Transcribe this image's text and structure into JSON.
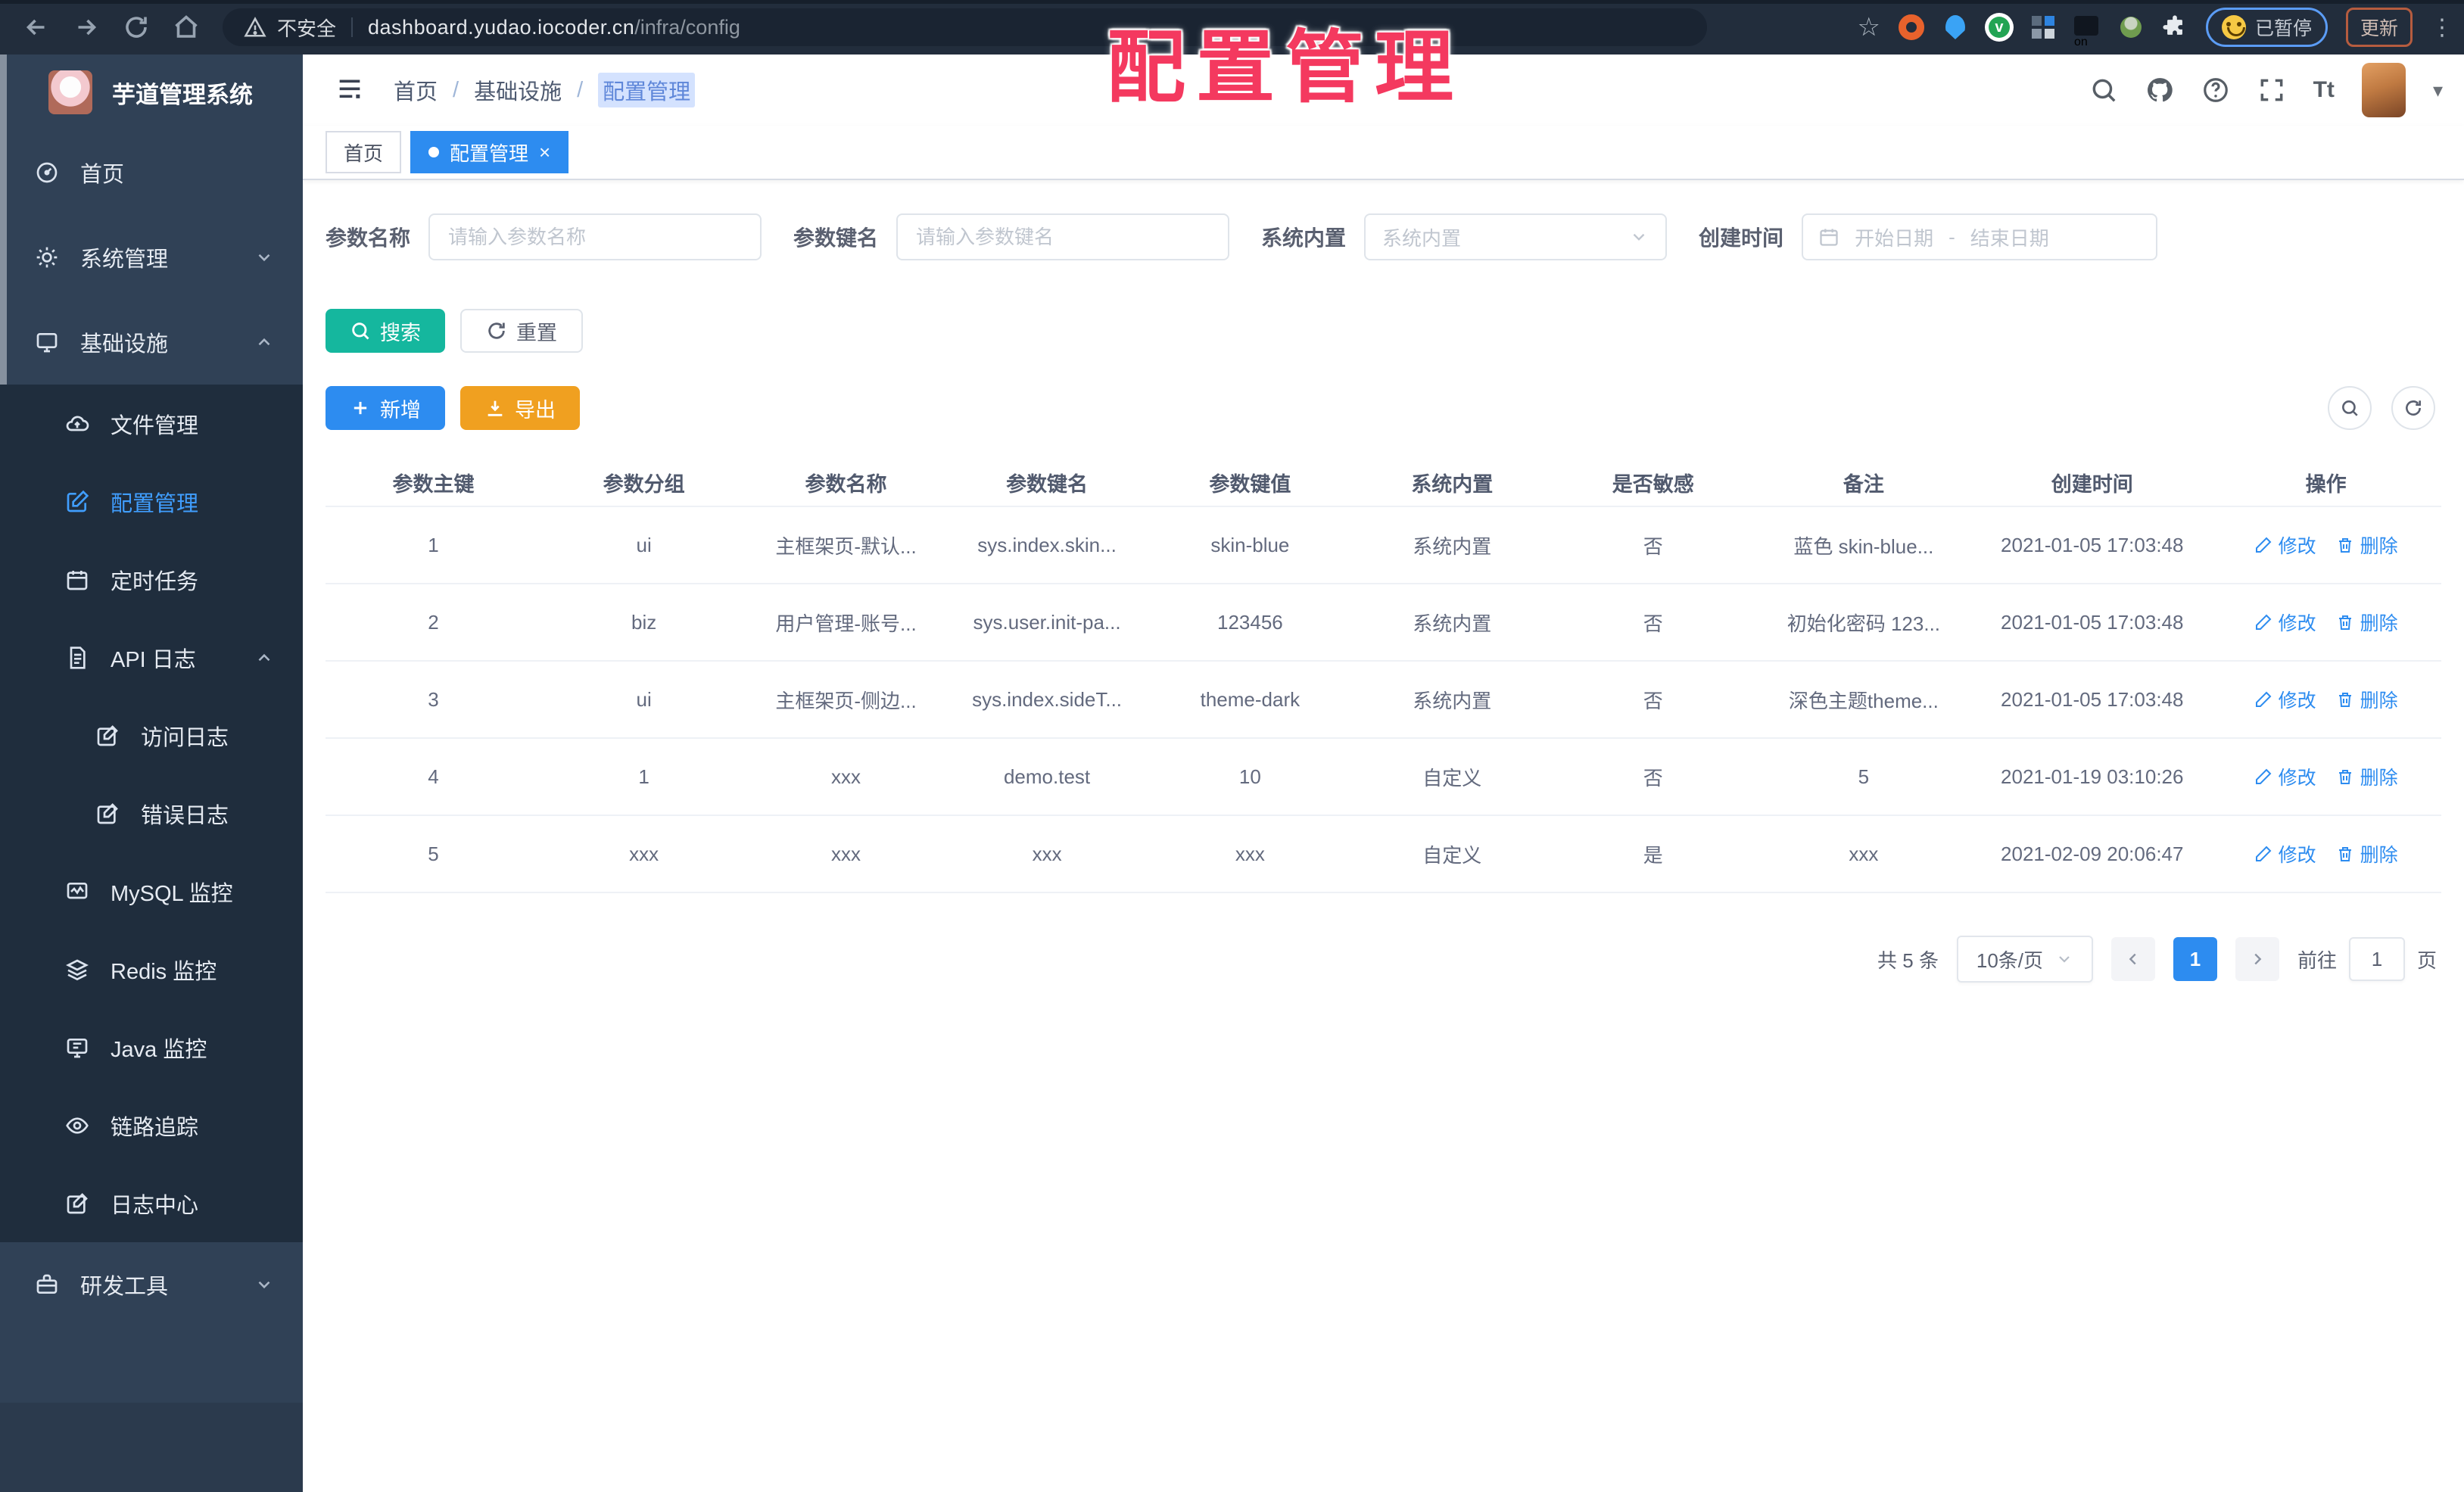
{
  "icons": {
    "close": "×",
    "caret_down": "▾",
    "kebab": "⋮",
    "star": "☆",
    "question": "?",
    "font_size": "Tt",
    "dash": "-"
  },
  "browser": {
    "security_label": "不安全",
    "url_host": "dashboard.yudao.iocoder.cn",
    "url_path": "/infra/config",
    "paused_label": "已暂停",
    "update_label": "更新",
    "on_badge": "on"
  },
  "overlay": {
    "title": "配置管理",
    "color": "#f4395f"
  },
  "sidebar": {
    "title": "芋道管理系统",
    "items": [
      {
        "label": "首页"
      },
      {
        "label": "系统管理"
      },
      {
        "label": "基础设施"
      },
      {
        "label": "文件管理"
      },
      {
        "label": "配置管理"
      },
      {
        "label": "定时任务"
      },
      {
        "label": "API 日志"
      },
      {
        "label": "访问日志"
      },
      {
        "label": "错误日志"
      },
      {
        "label": "MySQL 监控"
      },
      {
        "label": "Redis 监控"
      },
      {
        "label": "Java 监控"
      },
      {
        "label": "链路追踪"
      },
      {
        "label": "日志中心"
      },
      {
        "label": "研发工具"
      }
    ]
  },
  "header": {
    "breadcrumb": [
      "首页",
      "基础设施",
      "配置管理"
    ],
    "separator": "/"
  },
  "tabs": [
    {
      "label": "首页"
    },
    {
      "label": "配置管理"
    }
  ],
  "filters": {
    "param_name": {
      "label": "参数名称",
      "placeholder": "请输入参数名称",
      "value": ""
    },
    "param_key": {
      "label": "参数键名",
      "placeholder": "请输入参数键名",
      "value": ""
    },
    "system_builtin": {
      "label": "系统内置",
      "placeholder": "系统内置"
    },
    "create_time": {
      "label": "创建时间",
      "start_placeholder": "开始日期",
      "separator": "-",
      "end_placeholder": "结束日期"
    }
  },
  "buttons": {
    "search": "搜索",
    "reset": "重置",
    "add": "新增",
    "export": "导出"
  },
  "table": {
    "headers": [
      "参数主键",
      "参数分组",
      "参数名称",
      "参数键名",
      "参数键值",
      "系统内置",
      "是否敏感",
      "备注",
      "创建时间",
      "操作"
    ],
    "rows": [
      {
        "cells": [
          "1",
          "ui",
          "主框架页-默认...",
          "sys.index.skin...",
          "skin-blue",
          "系统内置",
          "否",
          "蓝色 skin-blue...",
          "2021-01-05 17:03:48"
        ]
      },
      {
        "cells": [
          "2",
          "biz",
          "用户管理-账号...",
          "sys.user.init-pa...",
          "123456",
          "系统内置",
          "否",
          "初始化密码 123...",
          "2021-01-05 17:03:48"
        ]
      },
      {
        "cells": [
          "3",
          "ui",
          "主框架页-侧边...",
          "sys.index.sideT...",
          "theme-dark",
          "系统内置",
          "否",
          "深色主题theme...",
          "2021-01-05 17:03:48"
        ]
      },
      {
        "cells": [
          "4",
          "1",
          "xxx",
          "demo.test",
          "10",
          "自定义",
          "否",
          "5",
          "2021-01-19 03:10:26"
        ]
      },
      {
        "cells": [
          "5",
          "xxx",
          "xxx",
          "xxx",
          "xxx",
          "自定义",
          "是",
          "xxx",
          "2021-02-09 20:06:47"
        ]
      }
    ],
    "edit_label": "修改",
    "delete_label": "删除"
  },
  "pagination": {
    "total": "共 5 条",
    "page_size": "10条/页",
    "current": "1",
    "goto_label": "前往",
    "page_unit": "页",
    "goto_value": "1"
  },
  "colors": {
    "primary": "#2d8cf0",
    "teal": "#15b79e",
    "warning": "#f0a020",
    "sidebar_bg": "#304156",
    "submenu_bg": "#1f2d3d",
    "overlay_red": "#f4395f"
  }
}
